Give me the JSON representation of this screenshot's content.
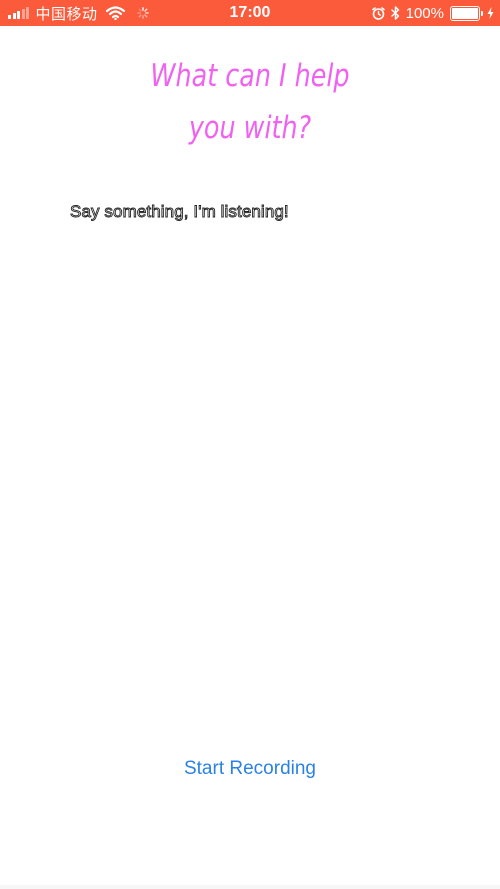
{
  "status_bar": {
    "carrier": "中国移动",
    "time": "17:00",
    "battery_percent": "100%",
    "background_color": "#fb5a3b",
    "icons": [
      "signal-icon",
      "wifi-icon",
      "activity-icon",
      "alarm-icon",
      "bluetooth-icon",
      "battery-icon",
      "charging-icon"
    ]
  },
  "headline": {
    "line1": "What can I help",
    "line2": "you with?",
    "color": "#f062f0"
  },
  "transcript": {
    "text": "Say something, I'm listening!"
  },
  "record_button": {
    "label": "Start Recording",
    "color": "#2a82e4"
  }
}
